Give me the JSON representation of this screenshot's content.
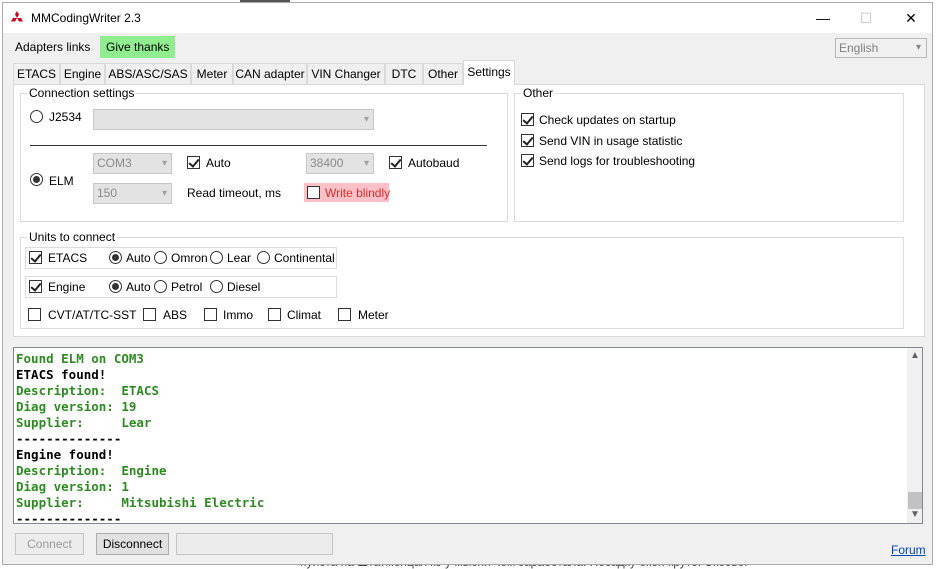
{
  "window": {
    "title": "MMCodingWriter 2.3",
    "controls": {
      "minimize": "—",
      "maximize": "☐",
      "close": "✕"
    }
  },
  "background": {
    "bottom_text": "пуйста на Штатмопцая кэ у мысни чем заработала. Посадку окоя круто: Эксово:"
  },
  "menu": {
    "adapters_links": "Adapters links",
    "give_thanks": "Give thanks",
    "language": "English"
  },
  "tabs": [
    "ETACS",
    "Engine",
    "ABS/ASC/SAS",
    "Meter",
    "CAN adapter",
    "VIN Changer",
    "DTC",
    "Other",
    "Settings"
  ],
  "active_tab": "Settings",
  "connection": {
    "title": "Connection settings",
    "j2534_label": "J2534",
    "j2534_selected": false,
    "j2534_device": "",
    "elm_label": "ELM",
    "elm_selected": true,
    "port": "COM3",
    "auto_label": "Auto",
    "auto_checked": true,
    "baud": "38400",
    "autobaud_label": "Autobaud",
    "autobaud_checked": true,
    "timeout": "150",
    "timeout_label": "Read timeout, ms",
    "write_blindly_label": "Write blindly",
    "write_blindly_checked": false
  },
  "other": {
    "title": "Other",
    "options": [
      {
        "label": "Check updates on startup",
        "checked": true
      },
      {
        "label": "Send VIN in usage statistic",
        "checked": true
      },
      {
        "label": "Send logs for troubleshooting",
        "checked": true
      }
    ]
  },
  "units": {
    "title": "Units to connect",
    "etacs": {
      "label": "ETACS",
      "checked": true,
      "options": [
        "Auto",
        "Omron",
        "Lear",
        "Continental"
      ],
      "selected": "Auto"
    },
    "engine": {
      "label": "Engine",
      "checked": true,
      "options": [
        "Auto",
        "Petrol",
        "Diesel"
      ],
      "selected": "Auto"
    },
    "extra": [
      {
        "label": "CVT/AT/TC-SST",
        "checked": false
      },
      {
        "label": "ABS",
        "checked": false
      },
      {
        "label": "Immo",
        "checked": false
      },
      {
        "label": "Climat",
        "checked": false
      },
      {
        "label": "Meter",
        "checked": false
      }
    ]
  },
  "log": [
    {
      "text": "Found ELM on COM3",
      "color": "#2e8b22"
    },
    {
      "text": "ETACS found!",
      "color": "#000000"
    },
    {
      "text": "Description:  ETACS",
      "color": "#2e8b22"
    },
    {
      "text": "Diag version: 19",
      "color": "#2e8b22"
    },
    {
      "text": "Supplier:     Lear",
      "color": "#2e8b22"
    },
    {
      "text": "--------------",
      "color": "#000000"
    },
    {
      "text": "Engine found!",
      "color": "#000000"
    },
    {
      "text": "Description:  Engine",
      "color": "#2e8b22"
    },
    {
      "text": "Diag version: 1",
      "color": "#2e8b22"
    },
    {
      "text": "Supplier:     Mitsubishi Electric",
      "color": "#2e8b22"
    },
    {
      "text": "--------------",
      "color": "#000000"
    }
  ],
  "footer": {
    "connect_label": "Connect",
    "connect_enabled": false,
    "disconnect_label": "Disconnect",
    "status_text": "",
    "forum_label": "Forum"
  },
  "colors": {
    "accent_green": "#90ee90",
    "warning_bg": "#ffb6c1",
    "warning_text": "#d32f2f",
    "log_green": "#2e8b22",
    "link_blue": "#0645ad",
    "logo_red": "#d0021b"
  },
  "icons": {
    "app": "mitsubishi-logo-icon",
    "dropdown": "chevron-down-icon",
    "scroll_up": "chevron-up-icon",
    "scroll_down": "chevron-down-icon"
  }
}
